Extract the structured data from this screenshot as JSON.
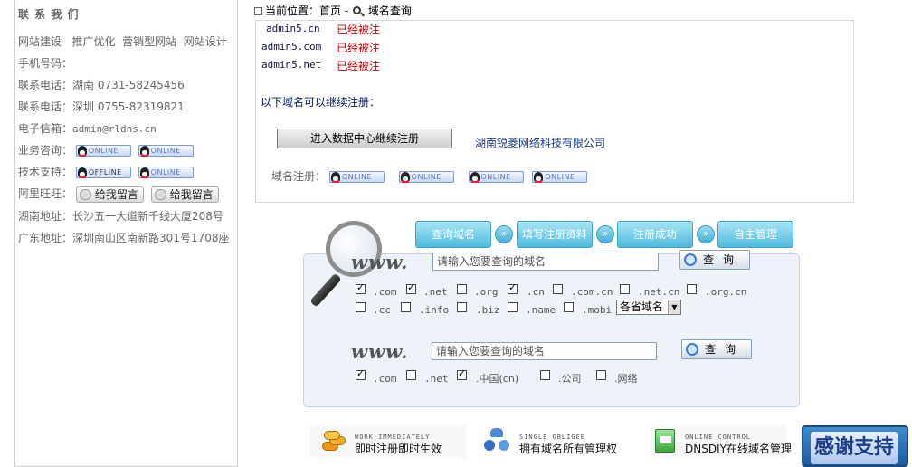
{
  "sidebar": {
    "title": "联 系 我 们",
    "services": [
      "网站建设",
      "推广优化",
      "营销型网站",
      "网站设计"
    ],
    "rows": [
      {
        "label": "手机号码：",
        "value": ""
      },
      {
        "label": "联系电话：",
        "value": "湖南 0731-58245456"
      },
      {
        "label": "联系电话：",
        "value": "深圳 0755-82319821"
      },
      {
        "label": "电子信箱：",
        "value": "admin@rldns.cn"
      },
      {
        "label": "业务咨询：",
        "value": ""
      },
      {
        "label": "技术支持：",
        "value": ""
      },
      {
        "label": "阿里旺旺：",
        "value": ""
      },
      {
        "label": "湖南地址：",
        "value": "长沙五一大道新千线大厦208号"
      },
      {
        "label": "广东地址：",
        "value": "深圳南山区南新路301号1708座"
      }
    ],
    "qq_online": "ONLINE",
    "qq_offline": "OFFLINE",
    "wangwang_label": "给我留言"
  },
  "location": {
    "prefix": "当前位置：",
    "home": "首页",
    "sep": "-",
    "current": "域名查询"
  },
  "result": {
    "items": [
      {
        "domain": "admin5.cn",
        "status": "已经被注"
      },
      {
        "domain": "admin5.com",
        "status": "已经被注"
      },
      {
        "domain": "admin5.net",
        "status": "已经被注"
      }
    ],
    "available_label": "以下域名可以继续注册：",
    "datacenter_button": "进入数据中心继续注册",
    "company": "湖南锐菱网络科技有限公司",
    "reg_label": "域名注册："
  },
  "steps": [
    "查询域名",
    "填写注册资料",
    "注册成功",
    "自主管理"
  ],
  "step_arrow": "»",
  "search": {
    "www": "www.",
    "placeholder": "请输入您要查询的域名",
    "query_button": "查 询",
    "tlds_row1": [
      {
        "name": ".com",
        "checked": true
      },
      {
        "name": ".net",
        "checked": true
      },
      {
        "name": ".org",
        "checked": false
      },
      {
        "name": ".cn",
        "checked": true
      },
      {
        "name": ".com.cn",
        "checked": false
      },
      {
        "name": ".net.cn",
        "checked": false
      },
      {
        "name": ".org.cn",
        "checked": false
      }
    ],
    "tlds_row2": [
      {
        "name": ".cc",
        "checked": false
      },
      {
        "name": ".info",
        "checked": false
      },
      {
        "name": ".biz",
        "checked": false
      },
      {
        "name": ".name",
        "checked": false
      },
      {
        "name": ".mobi",
        "checked": false
      }
    ],
    "province_select": "各省域名",
    "tlds_cn": [
      {
        "name": ".com",
        "checked": true
      },
      {
        "name": ".net",
        "checked": false
      },
      {
        "name": ".中国(cn)",
        "checked": true
      },
      {
        "name": ".公司",
        "checked": false
      },
      {
        "name": ".网络",
        "checked": false
      }
    ]
  },
  "features": [
    {
      "en": "WORK IMMEDIATELY",
      "zh": "即时注册即时生效"
    },
    {
      "en": "SINGLE OBLIGEE",
      "zh": "拥有域名所有管理权"
    },
    {
      "en": "ONLINE CONTROL",
      "zh": "DNSDIY在线域名管理"
    }
  ],
  "thanks": "感谢支持"
}
